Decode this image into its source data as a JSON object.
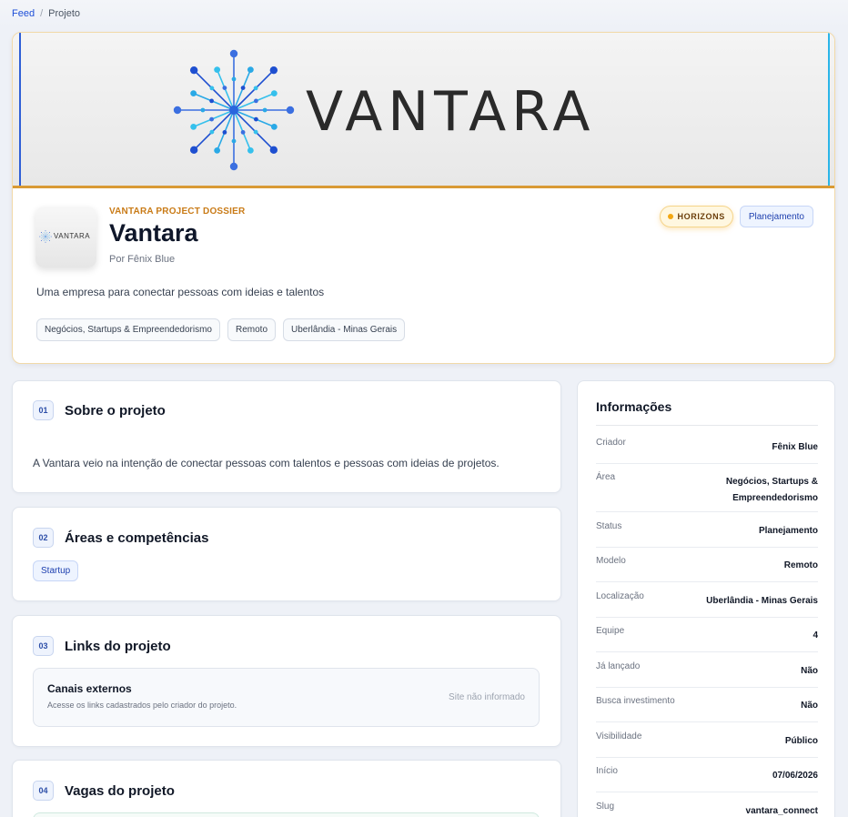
{
  "breadcrumb": {
    "feed": "Feed",
    "separator": "/",
    "current": "Projeto"
  },
  "hero": {
    "banner_wordmark": "VANTARA",
    "thumb_wordmark": "VANTARA",
    "eyebrow": "VANTARA PROJECT DOSSIER",
    "title": "Vantara",
    "byline": "Por Fênix Blue",
    "tagline": "Uma empresa para conectar pessoas com ideias e talentos",
    "tags": [
      "Negócios, Startups & Empreendedorismo",
      "Remoto",
      "Uberlândia - Minas Gerais"
    ],
    "badge_program": "HORIZONS",
    "badge_status": "Planejamento"
  },
  "sections": {
    "about": {
      "num": "01",
      "title": "Sobre o projeto",
      "text": "A Vantara veio na intenção de conectar pessoas com talentos e pessoas com ideias de projetos."
    },
    "skills": {
      "num": "02",
      "title": "Áreas e competências",
      "chips": [
        "Startup"
      ]
    },
    "links": {
      "num": "03",
      "title": "Links do projeto",
      "box_title": "Canais externos",
      "box_subtitle": "Acesse os links cadastrados pelo criador do projeto.",
      "empty": "Site não informado"
    },
    "jobs": {
      "num": "04",
      "title": "Vagas do projeto"
    }
  },
  "info": {
    "title": "Informações",
    "rows": [
      {
        "label": "Criador",
        "value": "Fênix Blue"
      },
      {
        "label": "Área",
        "value": "Negócios, Startups & Empreendedorismo"
      },
      {
        "label": "Status",
        "value": "Planejamento"
      },
      {
        "label": "Modelo",
        "value": "Remoto"
      },
      {
        "label": "Localização",
        "value": "Uberlândia - Minas Gerais"
      },
      {
        "label": "Equipe",
        "value": "4"
      },
      {
        "label": "Já lançado",
        "value": "Não"
      },
      {
        "label": "Busca investimento",
        "value": "Não"
      },
      {
        "label": "Visibilidade",
        "value": "Público"
      },
      {
        "label": "Início",
        "value": "07/06/2026"
      },
      {
        "label": "Slug",
        "value": "vantara_connect"
      }
    ]
  },
  "colors": {
    "accent": "#1d4ed8",
    "gold": "#d99a35",
    "eyebrow": "#c97b17"
  }
}
